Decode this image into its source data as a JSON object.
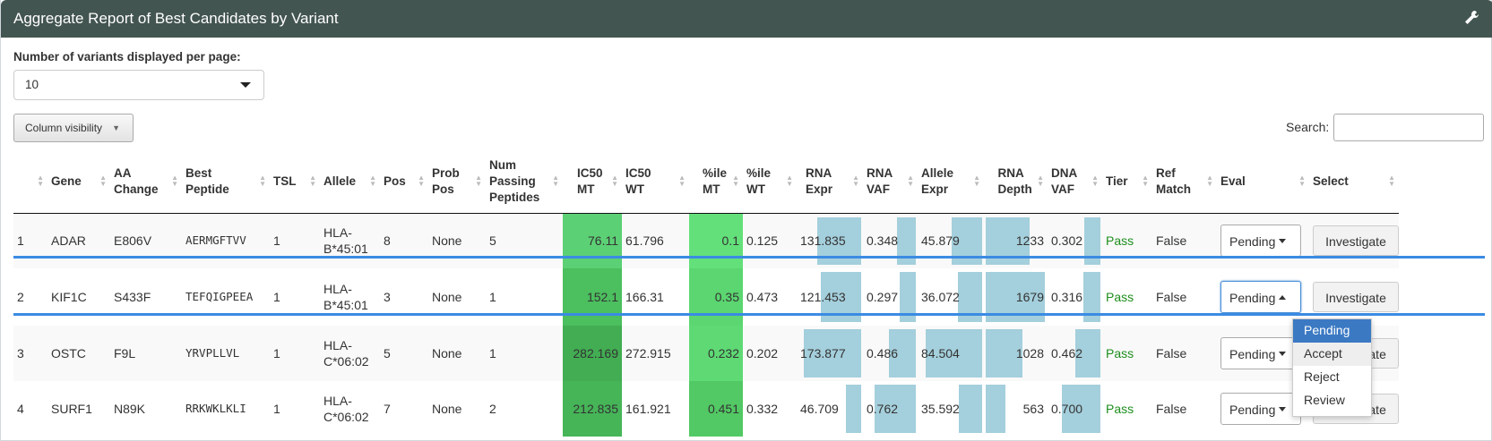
{
  "panel": {
    "title": "Aggregate Report of Best Candidates by Variant"
  },
  "perpage": {
    "label": "Number of variants displayed per page:",
    "value": "10"
  },
  "colvis": {
    "label": "Column visibility"
  },
  "search": {
    "label": "Search:",
    "value": ""
  },
  "columns": [
    "",
    "Gene",
    "AA Change",
    "Best Peptide",
    "TSL",
    "Allele",
    "Pos",
    "Prob Pos",
    "Num Passing Peptides",
    "IC50 MT",
    "IC50 WT",
    "%ile MT",
    "%ile WT",
    "RNA Expr",
    "RNA VAF",
    "Allele Expr",
    "RNA Depth",
    "DNA VAF",
    "Tier",
    "Ref Match",
    "Eval",
    "Select"
  ],
  "rows": [
    {
      "num": "1",
      "gene": "ADAR",
      "aa": "E806V",
      "peptide": "AERMGFTVV",
      "tsl": "1",
      "allele": "HLA-B*45:01",
      "pos": "8",
      "probpos": "None",
      "npass": "5",
      "ic50mt": "76.11",
      "ic50wt": "61.796",
      "pmt": "0.1",
      "pwt": "0.125",
      "rnaexpr": "131.835",
      "rnavaf": "0.348",
      "alleleexpr": "45.879",
      "rnadepth": "1233",
      "dnavaf": "0.302",
      "tier": "Pass",
      "ref": "False",
      "eval": "Pending",
      "select": "Investigate"
    },
    {
      "num": "2",
      "gene": "KIF1C",
      "aa": "S433F",
      "peptide": "TEFQIGPEEA",
      "tsl": "1",
      "allele": "HLA-B*45:01",
      "pos": "3",
      "probpos": "None",
      "npass": "1",
      "ic50mt": "152.1",
      "ic50wt": "166.31",
      "pmt": "0.35",
      "pwt": "0.473",
      "rnaexpr": "121.453",
      "rnavaf": "0.297",
      "alleleexpr": "36.072",
      "rnadepth": "1679",
      "dnavaf": "0.316",
      "tier": "Pass",
      "ref": "False",
      "eval": "Pending",
      "select": "Investigate"
    },
    {
      "num": "3",
      "gene": "OSTC",
      "aa": "F9L",
      "peptide": "YRVPLLVL",
      "tsl": "1",
      "allele": "HLA-C*06:02",
      "pos": "5",
      "probpos": "None",
      "npass": "1",
      "ic50mt": "282.169",
      "ic50wt": "272.915",
      "pmt": "0.232",
      "pwt": "0.202",
      "rnaexpr": "173.877",
      "rnavaf": "0.486",
      "alleleexpr": "84.504",
      "rnadepth": "1028",
      "dnavaf": "0.462",
      "tier": "Pass",
      "ref": "False",
      "eval": "Pending",
      "select": "Investigate"
    },
    {
      "num": "4",
      "gene": "SURF1",
      "aa": "N89K",
      "peptide": "RRKWKLKLI",
      "tsl": "1",
      "allele": "HLA-C*06:02",
      "pos": "7",
      "probpos": "None",
      "npass": "2",
      "ic50mt": "212.835",
      "ic50wt": "161.921",
      "pmt": "0.451",
      "pwt": "0.332",
      "rnaexpr": "46.709",
      "rnavaf": "0.762",
      "alleleexpr": "35.592",
      "rnadepth": "563",
      "dnavaf": "0.700",
      "tier": "Pass",
      "ref": "False",
      "eval": "Pending",
      "select": "Investigate"
    }
  ],
  "dropdown": {
    "options": [
      "Pending",
      "Accept",
      "Reject",
      "Review"
    ],
    "selected": "Pending"
  },
  "colors": {
    "header": "#435550",
    "ic50": [
      "#5cd075",
      "#4cbf5f",
      "#42ad52",
      "#46b558"
    ],
    "pmt": [
      "#63e07a",
      "#5bd670",
      "#5ed974",
      "#52c964"
    ],
    "bar": "#a4cfdc",
    "pass": "#1e8e1e"
  }
}
